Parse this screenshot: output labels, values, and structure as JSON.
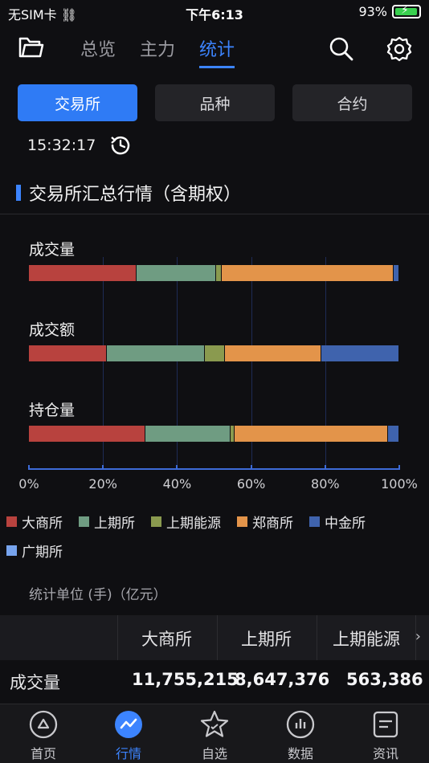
{
  "status": {
    "carrier": "无SIM卡",
    "time": "下午6:13",
    "battery": "93%"
  },
  "nav": {
    "tabs": [
      "总览",
      "主力",
      "统计"
    ],
    "active": 2
  },
  "segments": {
    "items": [
      "交易所",
      "品种",
      "合约"
    ],
    "active": 0
  },
  "timestamp": "15:32:17",
  "section_title": "交易所汇总行情（含期权）",
  "chart_data": {
    "type": "bar",
    "orientation": "horizontal-stacked-100",
    "categories": [
      "成交量",
      "成交额",
      "持仓量"
    ],
    "series": [
      {
        "name": "大商所",
        "color": "#b8423e",
        "values": [
          29,
          21,
          31.5
        ]
      },
      {
        "name": "上期所",
        "color": "#6f9c82",
        "values": [
          21.5,
          26.5,
          23
        ]
      },
      {
        "name": "上期能源",
        "color": "#8a9a4f",
        "values": [
          1.5,
          5.5,
          1
        ]
      },
      {
        "name": "郑商所",
        "color": "#e3944a",
        "values": [
          46.5,
          26,
          41.5
        ]
      },
      {
        "name": "中金所",
        "color": "#3f63ad",
        "values": [
          1.5,
          21,
          3
        ]
      },
      {
        "name": "广期所",
        "color": "#77a4ee",
        "values": [
          0,
          0,
          0
        ]
      }
    ],
    "xlim": [
      0,
      100
    ],
    "xticks": [
      "0%",
      "20%",
      "40%",
      "60%",
      "80%",
      "100%"
    ],
    "legend": "bottom"
  },
  "unit_note": "统计单位 (手)（亿元）",
  "table": {
    "headers": [
      "大商所",
      "上期所",
      "上期能源"
    ],
    "rows": [
      {
        "label": "成交量",
        "values": [
          "11,755,215",
          "8,647,376",
          "563,386"
        ]
      }
    ]
  },
  "bottomnav": {
    "items": [
      "首页",
      "行情",
      "自选",
      "数据",
      "资讯"
    ],
    "active": 1
  }
}
